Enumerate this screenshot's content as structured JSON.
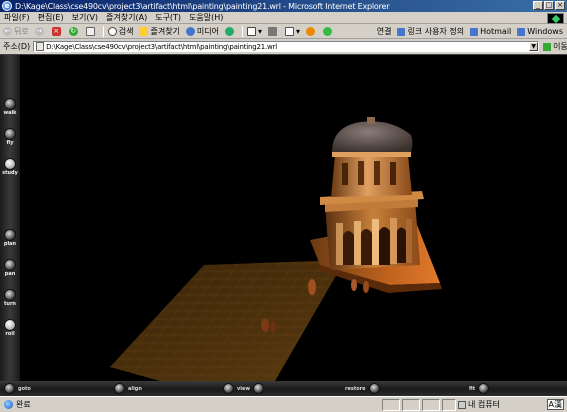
{
  "window": {
    "title": "D:\\Kage\\Class\\cse490cv\\project3\\artifact\\html\\painting\\painting21.wrl - Microsoft Internet Explorer",
    "controls": [
      "_",
      "□",
      "×"
    ]
  },
  "menu": [
    "파일(F)",
    "편집(E)",
    "보기(V)",
    "즐겨찾기(A)",
    "도구(T)",
    "도움말(H)"
  ],
  "toolbar": {
    "back_label": "뒤로",
    "search_label": "검색",
    "favorites_label": "즐겨찾기",
    "media_label": "미디어",
    "links_label": "연결",
    "links": [
      "링크 사용자 정의",
      "Hotmail",
      "Windows"
    ]
  },
  "address": {
    "label": "주소(D)",
    "url": "D:\\Kage\\Class\\cse490cv\\project3\\artifact\\html\\painting\\painting21.wrl",
    "go_label": "이동"
  },
  "vrml_nav": {
    "left_buttons": [
      "walk",
      "fly",
      "study",
      "plan",
      "pan",
      "turn",
      "roll"
    ],
    "active_mode": "study",
    "bottom_buttons": [
      "goto",
      "align",
      "view",
      "restore",
      "fit"
    ]
  },
  "status": {
    "text": "완료",
    "zone": "내 컴퓨터",
    "ime": "A漢"
  }
}
